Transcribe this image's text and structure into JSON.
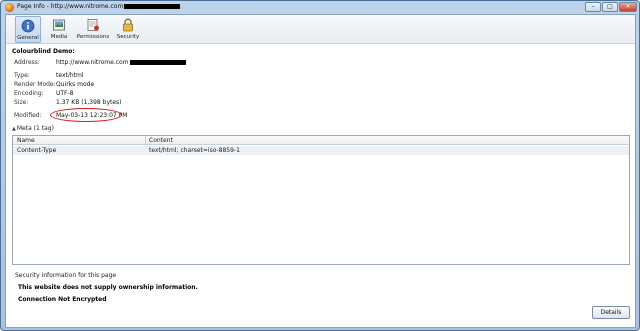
{
  "window": {
    "title": "Page Info - http://www.nitrome.com",
    "controls": {
      "minimize": "–",
      "maximize": "□",
      "close": "✕"
    }
  },
  "tabs": [
    {
      "label": "General",
      "icon": "info-icon",
      "active": true
    },
    {
      "label": "Media",
      "icon": "media-icon",
      "active": false
    },
    {
      "label": "Permissions",
      "icon": "permissions-icon",
      "active": false
    },
    {
      "label": "Security",
      "icon": "lock-icon",
      "active": false
    }
  ],
  "general": {
    "heading": "Colourblind Demo:",
    "address_label": "Address:",
    "address_value": "http://www.nitrome.com",
    "type_label": "Type:",
    "type_value": "text/html",
    "render_label": "Render Mode:",
    "render_value": "Quirks mode",
    "encoding_label": "Encoding:",
    "encoding_value": "UTF-8",
    "size_label": "Size:",
    "size_value": "1.37 KB (1,398 bytes)",
    "modified_label": "Modified:",
    "modified_value": "May-03-13 12:23:07 PM"
  },
  "meta": {
    "toggle_label": "Meta (1 tag)",
    "columns": [
      "Name",
      "Content"
    ],
    "rows": [
      {
        "name": "Content-Type",
        "content": "text/html; charset=iso-8859-1"
      }
    ]
  },
  "security": {
    "label": "Security information for this page",
    "owner": "This website does not supply ownership information.",
    "encryption": "Connection Not Encrypted",
    "details_button": "Details"
  },
  "colors": {
    "accent": "#c4d8ee",
    "highlight_circle": "#d31a1a"
  }
}
